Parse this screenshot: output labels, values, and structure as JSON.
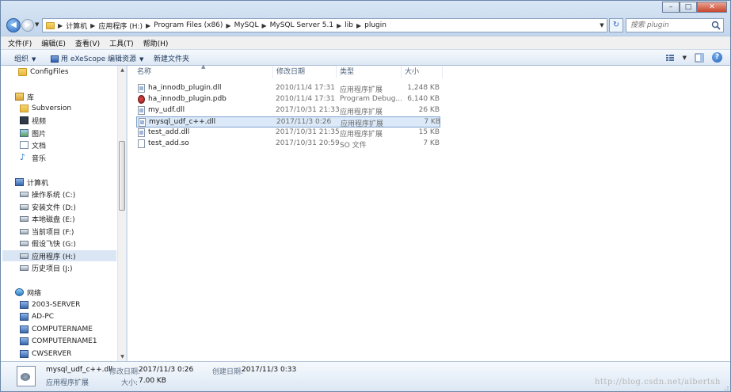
{
  "address": {
    "crumbs": [
      "计算机",
      "应用程序 (H:)",
      "Program Files (x86)",
      "MySQL",
      "MySQL Server 5.1",
      "lib",
      "plugin"
    ]
  },
  "search": {
    "placeholder": "搜索 plugin"
  },
  "menu": [
    "文件(F)",
    "编辑(E)",
    "查看(V)",
    "工具(T)",
    "帮助(H)"
  ],
  "toolbar": {
    "organize": "组织",
    "exescope": "用 eXeScope 编辑资源",
    "new_folder": "新建文件夹"
  },
  "nav": {
    "configfiles": "ConfigFiles",
    "library": "库",
    "subversion": "Subversion",
    "video": "视频",
    "images": "图片",
    "docs": "文档",
    "music": "音乐",
    "computer": "计算机",
    "drive_c": "操作系统 (C:)",
    "drive_d": "安装文件 (D:)",
    "drive_e": "本地磁盘 (E:)",
    "drive_f": "当前项目 (F:)",
    "drive_g": "假设飞快 (G:)",
    "drive_h": "应用程序 (H:)",
    "drive_j": "历史项目 (J:)",
    "network": "网络",
    "net1": "2003-SERVER",
    "net2": "AD-PC",
    "net3": "COMPUTERNAME",
    "net4": "COMPUTERNAME1",
    "net5": "CWSERVER"
  },
  "columns": {
    "name": "名称",
    "date": "修改日期",
    "type": "类型",
    "size": "大小"
  },
  "files": [
    {
      "name": "ha_innodb_plugin.dll",
      "date": "2010/11/4 17:31",
      "type": "应用程序扩展",
      "size": "1,248 KB"
    },
    {
      "name": "ha_innodb_plugin.pdb",
      "date": "2010/11/4 17:31",
      "type": "Program Debug...",
      "size": "6,140 KB"
    },
    {
      "name": "my_udf.dll",
      "date": "2017/10/31 21:33",
      "type": "应用程序扩展",
      "size": "26 KB"
    },
    {
      "name": "mysql_udf_c++.dll",
      "date": "2017/11/3 0:26",
      "type": "应用程序扩展",
      "size": "7 KB"
    },
    {
      "name": "test_add.dll",
      "date": "2017/10/31 21:35",
      "type": "应用程序扩展",
      "size": "15 KB"
    },
    {
      "name": "test_add.so",
      "date": "2017/10/31 20:59",
      "type": "SO 文件",
      "size": "7 KB"
    }
  ],
  "details": {
    "name": "mysql_udf_c++.dll",
    "type": "应用程序扩展",
    "modified_label": "修改日期:",
    "modified_value": "2017/11/3 0:26",
    "size_label": "大小:",
    "size_value": "7.00 KB",
    "created_label": "创建日期:",
    "created_value": "2017/11/3 0:33",
    "watermark": "http://blog.csdn.net/albertsh"
  },
  "colors": {
    "selection": "#dce9f8",
    "selection_border": "#7da2ce",
    "chrome": "#c9dbee"
  }
}
